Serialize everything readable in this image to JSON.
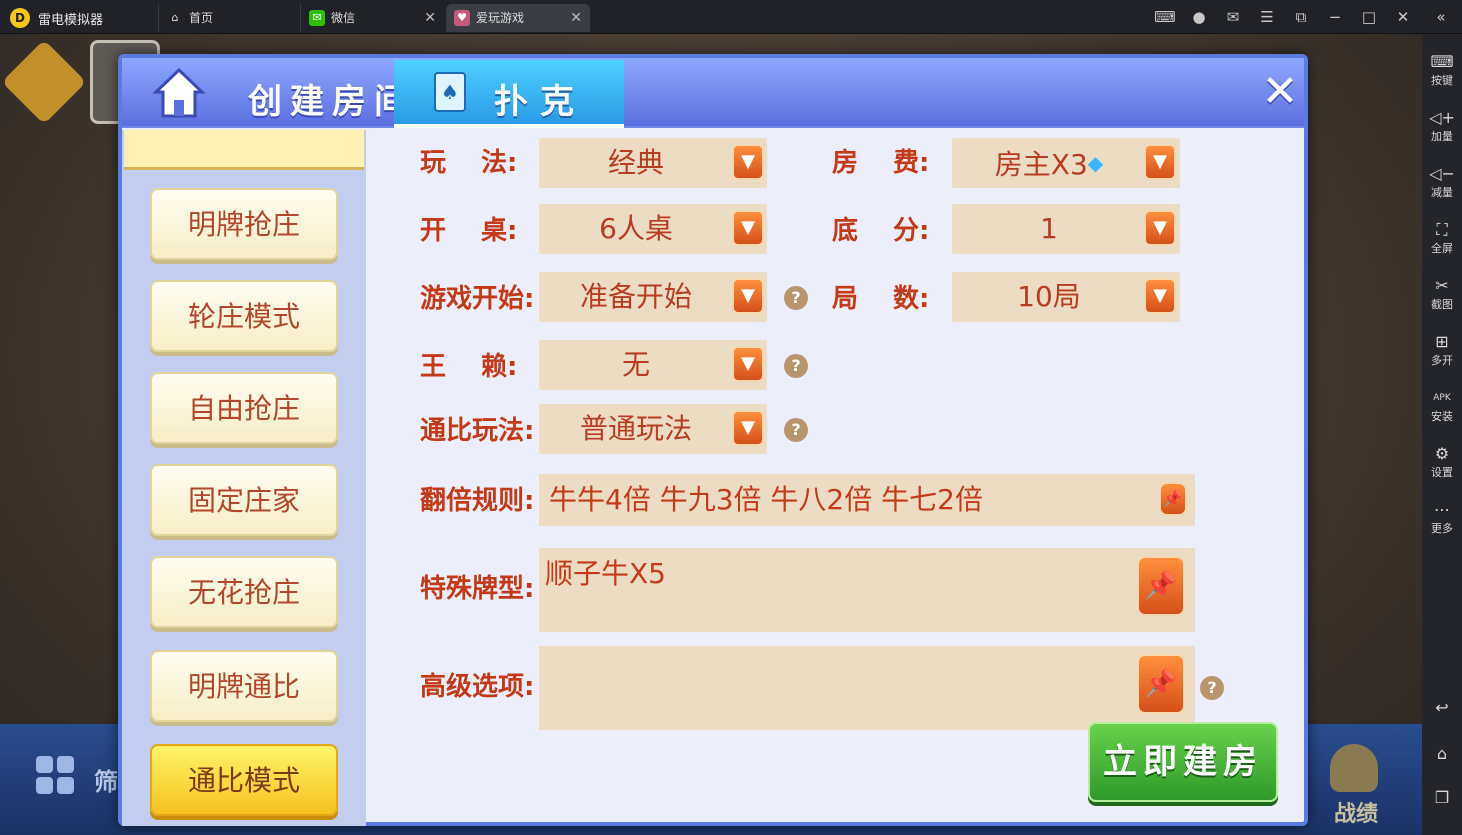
{
  "emulator": {
    "app_name": "雷电模拟器",
    "tabs": [
      {
        "label": "首页"
      },
      {
        "label": "微信"
      },
      {
        "label": "爱玩游戏"
      }
    ],
    "window_controls": [
      "gamepad-icon",
      "account-icon",
      "mail-icon",
      "menu-icon",
      "popout-icon",
      "minimize-icon",
      "maximize-icon",
      "close-icon",
      "collapse-icon"
    ]
  },
  "sidebar": {
    "items": [
      {
        "label": "按键",
        "icon": "keyboard-icon"
      },
      {
        "label": "加量",
        "icon": "volume-up-icon"
      },
      {
        "label": "减量",
        "icon": "volume-down-icon"
      },
      {
        "label": "全屏",
        "icon": "fullscreen-icon"
      },
      {
        "label": "截图",
        "icon": "scissors-icon"
      },
      {
        "label": "多开",
        "icon": "multi-instance-icon"
      },
      {
        "label": "安装",
        "icon": "apk-icon"
      },
      {
        "label": "设置",
        "icon": "settings-icon"
      },
      {
        "label": "更多",
        "icon": "more-icon"
      }
    ],
    "bottom_icons": [
      "back-icon",
      "home-icon",
      "recent-apps-icon"
    ]
  },
  "background": {
    "filter_label": "筛",
    "record_label": "战绩"
  },
  "dialog": {
    "title": "创建房间",
    "tab_label": "扑克",
    "modes": [
      {
        "label": "明牌抢庄",
        "active": false
      },
      {
        "label": "轮庄模式",
        "active": false
      },
      {
        "label": "自由抢庄",
        "active": false
      },
      {
        "label": "固定庄家",
        "active": false
      },
      {
        "label": "无花抢庄",
        "active": false
      },
      {
        "label": "明牌通比",
        "active": false
      },
      {
        "label": "通比模式",
        "active": true
      }
    ],
    "settings": {
      "play": {
        "label": "玩　 法:",
        "value": "经典"
      },
      "fee": {
        "label": "房　 费:",
        "value": "房主X3"
      },
      "table": {
        "label": "开　 桌:",
        "value": "6人桌"
      },
      "base": {
        "label": "底　 分:",
        "value": "1"
      },
      "start": {
        "label": "游戏开始:",
        "value": "准备开始"
      },
      "rounds": {
        "label": "局　 数:",
        "value": "10局"
      },
      "wild": {
        "label": "王　 赖:",
        "value": "无"
      },
      "compare": {
        "label": "通比玩法:",
        "value": "普通玩法"
      },
      "multiplier": {
        "label": "翻倍规则:",
        "value": "牛牛4倍 牛九3倍 牛八2倍 牛七2倍"
      },
      "special": {
        "label": "特殊牌型:",
        "value": "顺子牛X5"
      },
      "advanced": {
        "label": "高级选项:",
        "value": ""
      }
    },
    "create_button": "立即建房"
  },
  "colors": {
    "accent_label": "#c43a18",
    "dialog_border": "#5b7be0",
    "active_tab": "#2a9ae6",
    "create_button": "#2f9a2a"
  }
}
